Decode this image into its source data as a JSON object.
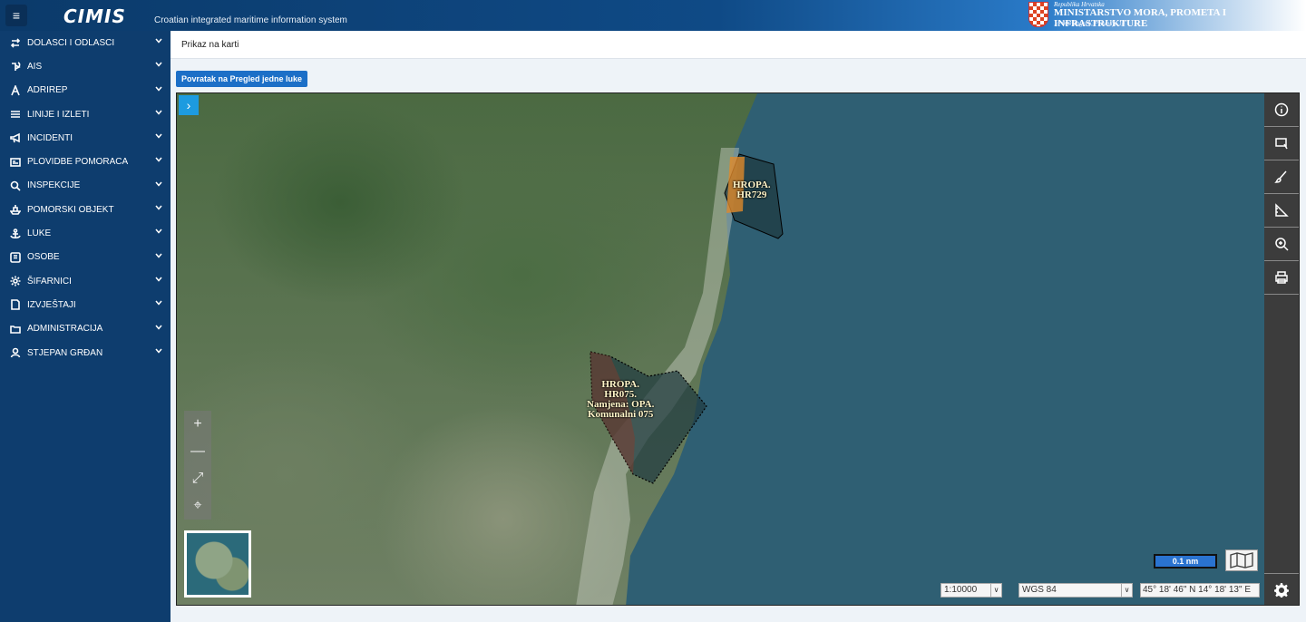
{
  "header": {
    "menu_icon": "hamburger-icon",
    "logo_text": "CIMIS",
    "tagline": "Croatian integrated maritime information system",
    "ministry": {
      "line1": "Republika Hrvatska",
      "line2": "MINISTARSTVO MORA, PROMETA I INFRASTRUKTURE",
      "line3": "10 000 Zagreb, Prisavlje 14"
    }
  },
  "sidebar": {
    "items": [
      {
        "label": "DOLASCI I ODLASCI",
        "icon": "arrows-exchange-icon"
      },
      {
        "label": "AIS",
        "icon": "ship-signal-icon"
      },
      {
        "label": "ADRIREP",
        "icon": "letter-a-icon"
      },
      {
        "label": "LINIJE I IZLETI",
        "icon": "list-icon"
      },
      {
        "label": "INCIDENTI",
        "icon": "megaphone-icon"
      },
      {
        "label": "PLOVIDBE POMORACA",
        "icon": "id-card-icon"
      },
      {
        "label": "INSPEKCIJE",
        "icon": "search-icon"
      },
      {
        "label": "POMORSKI OBJEKT",
        "icon": "ship-icon"
      },
      {
        "label": "LUKE",
        "icon": "anchor-icon"
      },
      {
        "label": "OSOBE",
        "icon": "person-card-icon"
      },
      {
        "label": "ŠIFARNICI",
        "icon": "gear-icon"
      },
      {
        "label": "IZVJEŠTAJI",
        "icon": "document-icon"
      },
      {
        "label": "ADMINISTRACIJA",
        "icon": "folder-icon"
      },
      {
        "label": "STJEPAN GRĐAN",
        "icon": "user-icon"
      }
    ]
  },
  "breadcrumb": "Prikaz na karti",
  "back_button": "Povratak na Pregled jedne luke",
  "map": {
    "polygon_labels": [
      {
        "lines": [
          "HROPA.",
          "HR729"
        ]
      },
      {
        "lines": [
          "HROPA.",
          "HR075.",
          "Namjena: OPA.",
          "Komunalni 075"
        ]
      }
    ],
    "scale_label": "0.1 nm",
    "scale_select": "1:10000",
    "crs_select": "WGS 84",
    "coordinates": "45° 18' 46\" N 14° 18' 13\" E",
    "colors": {
      "sea": "#2f5f73",
      "polygon_fill": "#1f3a40",
      "parcel": "#e08a2a",
      "accent": "#1d9be0"
    }
  }
}
